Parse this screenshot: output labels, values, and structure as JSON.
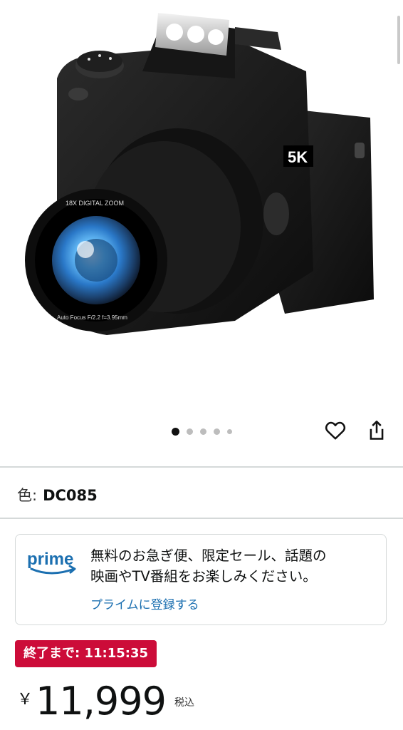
{
  "product": {
    "image_alt": "camera-product-image",
    "lens_text_top": "18X DIGITAL ZOOM",
    "lens_text_bottom": "Auto Focus F/2.2 f=3.95mm",
    "body_badge": "5K"
  },
  "carousel": {
    "count": 5,
    "active_index": 0
  },
  "actions": {
    "wishlist_icon": "heart-outline-icon",
    "share_icon": "share-icon"
  },
  "color": {
    "label": "色:",
    "value": "DC085"
  },
  "prime": {
    "logo_text": "prime",
    "line1": "無料のお急ぎ便、限定セール、話題の",
    "line2": "映画やTV番組をお楽しみください。",
    "link": "プライムに登録する",
    "accent": "#1b6fb0"
  },
  "deal": {
    "text": "終了まで: 11:15:35",
    "color": "#cc0c39"
  },
  "price": {
    "currency": "￥",
    "amount": "11,999",
    "tax_note": "税込"
  }
}
